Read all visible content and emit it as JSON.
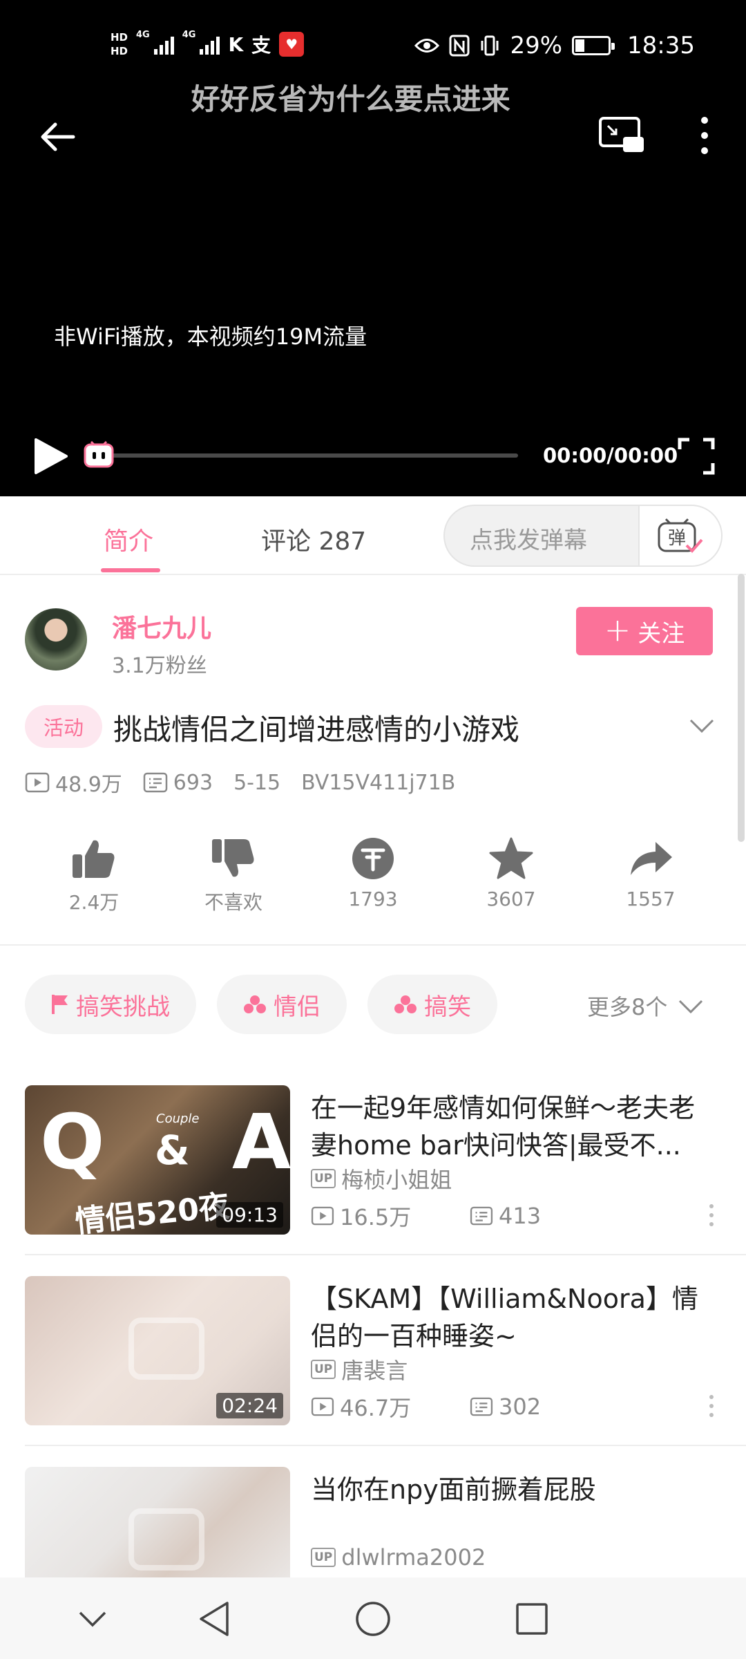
{
  "status_bar": {
    "hd1": "HD",
    "hd2": "HD",
    "gen1": "4G",
    "gen2": "4G",
    "battery_text": "29%",
    "battery_level": 0.29,
    "time": "18:35",
    "icons": [
      "eye-icon",
      "nfc-icon",
      "vibrate-icon",
      "battery-icon"
    ]
  },
  "player": {
    "title": "好好反省为什么要点进来",
    "wifi_notice": "非WiFi播放，本视频约19M流量",
    "time": "00:00/00:00",
    "progress": 0.0
  },
  "tabs": {
    "intro": "简介",
    "comments": "评论 287",
    "danmaku_placeholder": "点我发弹幕",
    "danmaku_btn": "弹"
  },
  "author": {
    "name": "潘七九儿",
    "fans": "3.1万粉丝",
    "follow_label": "关注",
    "follow_plus": "+"
  },
  "video": {
    "tag": "活动",
    "title": "挑战情侣之间增进感情的小游戏",
    "views": "48.9万",
    "danmaku": "693",
    "date": "5-15",
    "bvid": "BV15V411j71B"
  },
  "actions": [
    {
      "label": "2.4万",
      "icon": "thumbs-up-icon"
    },
    {
      "label": "不喜欢",
      "icon": "thumbs-down-icon"
    },
    {
      "label": "1793",
      "icon": "coin-icon"
    },
    {
      "label": "3607",
      "icon": "star-icon"
    },
    {
      "label": "1557",
      "icon": "share-icon"
    }
  ],
  "chips": [
    {
      "label": "搞笑挑战",
      "icon": "flag-icon"
    },
    {
      "label": "情侣",
      "icon": "channel-icon"
    },
    {
      "label": "搞笑",
      "icon": "channel-icon"
    }
  ],
  "more_chips": "更多8个",
  "related": [
    {
      "title": "在一起9年感情如何保鲜～老夫老妻home bar快问快答|最受不...",
      "up": "梅桢小姐姐",
      "views": "16.5万",
      "danmaku": "413",
      "duration": "09:13",
      "cover_text": {
        "q": "Q",
        "a": "A",
        "amp": "&",
        "couple": "Couple",
        "cn": "情侣520夜"
      }
    },
    {
      "title": "【SKAM】【William&Noora】情侣的一百种睡姿~",
      "up": "唐裴言",
      "views": "46.7万",
      "danmaku": "302",
      "duration": "02:24"
    },
    {
      "title": "当你在npy面前撅着屁股",
      "up": "dlwlrma2002"
    }
  ],
  "up_badge": "UP",
  "colors": {
    "accent": "#fb7299",
    "player_bg": "#000000",
    "text_secondary": "#8a8a8a"
  }
}
